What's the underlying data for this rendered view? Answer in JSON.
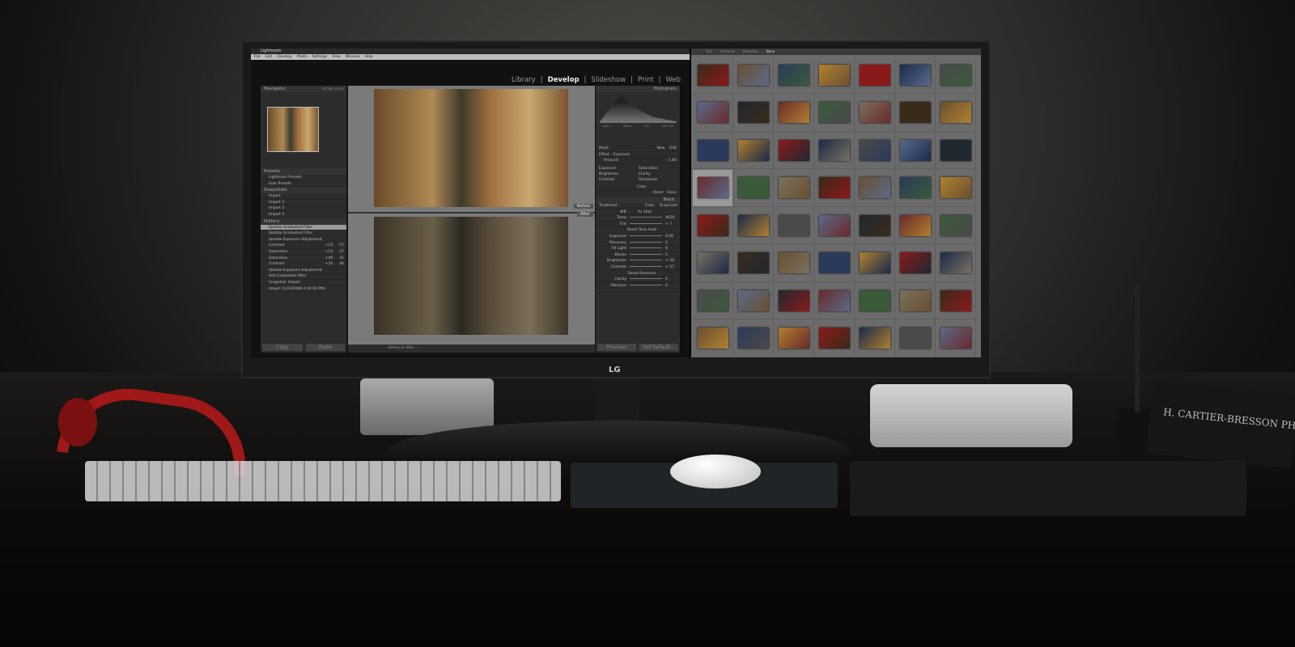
{
  "window": {
    "title": "Lightroom",
    "menu": [
      "File",
      "Edit",
      "Develop",
      "Photo",
      "Settings",
      "View",
      "Window",
      "Help"
    ]
  },
  "modules": [
    "Library",
    "Develop",
    "Slideshow",
    "Print",
    "Web"
  ],
  "active_module": "Develop",
  "left_panel": {
    "navigator": {
      "title": "Navigator",
      "zoom": "FIT  FILL  1:1  3:1"
    },
    "presets": {
      "title": "Presets",
      "items": [
        "Lightroom Presets",
        "User Presets"
      ]
    },
    "snapshots": {
      "title": "Snapshots",
      "items": [
        "Import",
        "Import 2",
        "Import 3",
        "Import 4"
      ]
    },
    "history": {
      "title": "History",
      "items": [
        {
          "label": "Update Graduated Filter",
          "a": "",
          "b": ""
        },
        {
          "label": "Update Graduated Filter",
          "a": "",
          "b": ""
        },
        {
          "label": "Update Exposure Adjustment",
          "a": "",
          "b": ""
        },
        {
          "label": "Contrast",
          "a": "+13",
          "b": "57"
        },
        {
          "label": "Saturation",
          "a": "+13",
          "b": "57"
        },
        {
          "label": "Saturation",
          "a": "+40",
          "b": "41"
        },
        {
          "label": "Contrast",
          "a": "+10",
          "b": "46"
        },
        {
          "label": "Update Exposure Adjustment",
          "a": "",
          "b": ""
        },
        {
          "label": "Add Graduated Filter",
          "a": "",
          "b": ""
        },
        {
          "label": "Snapshot: Import",
          "a": "",
          "b": ""
        },
        {
          "label": "Import (1/16/2008 2:04:02 PM)",
          "a": "",
          "b": ""
        }
      ]
    },
    "copy": "Copy",
    "paste": "Paste"
  },
  "center": {
    "before": "Before",
    "after": "After",
    "toolbar_label": "Before & After :"
  },
  "right_panel": {
    "histogram": {
      "title": "Histogram",
      "info": [
        "1/60 s",
        "28mm",
        "f/11",
        "ISO 100"
      ]
    },
    "mask": {
      "label": "Mask :",
      "new": "New",
      "edit": "Edit"
    },
    "effect": {
      "label": "Effect :",
      "value": "Exposure",
      "amount_label": "Amount",
      "amount": "- 1.80"
    },
    "toggles": [
      "Exposure",
      "Saturation",
      "Brightness",
      "Clarity",
      "Contrast",
      "Sharpness"
    ],
    "color_label": "Color",
    "reset": "Reset",
    "close": "Close",
    "basic": {
      "title": "Basic",
      "treatment": "Treatment :",
      "color": "Color",
      "grayscale": "Grayscale",
      "wb": "WB :",
      "wb_value": "As Shot",
      "sliders": [
        {
          "label": "Temp",
          "value": "4650"
        },
        {
          "label": "Tint",
          "value": "+ 7"
        }
      ],
      "tone_title": "Reset Tone",
      "auto": "Auto",
      "tone": [
        {
          "label": "Exposure",
          "value": "0.00"
        },
        {
          "label": "Recovery",
          "value": "0"
        },
        {
          "label": "Fill Light",
          "value": "0"
        },
        {
          "label": "Blacks",
          "value": "5"
        },
        {
          "label": "Brightness",
          "value": "+ 50"
        },
        {
          "label": "Contrast",
          "value": "+ 57"
        }
      ],
      "presence_title": "Reset Presence",
      "presence": [
        {
          "label": "Clarity",
          "value": "0"
        },
        {
          "label": "Vibrance",
          "value": "0"
        }
      ]
    },
    "previous": "Previous",
    "set_default": "Set Default..."
  },
  "grid": {
    "filters": [
      "Text",
      "Attribute",
      "Metadata",
      "None"
    ]
  },
  "monitor_brand": "LG",
  "book_spine": "H. CARTIER-BRESSON PHOTO"
}
